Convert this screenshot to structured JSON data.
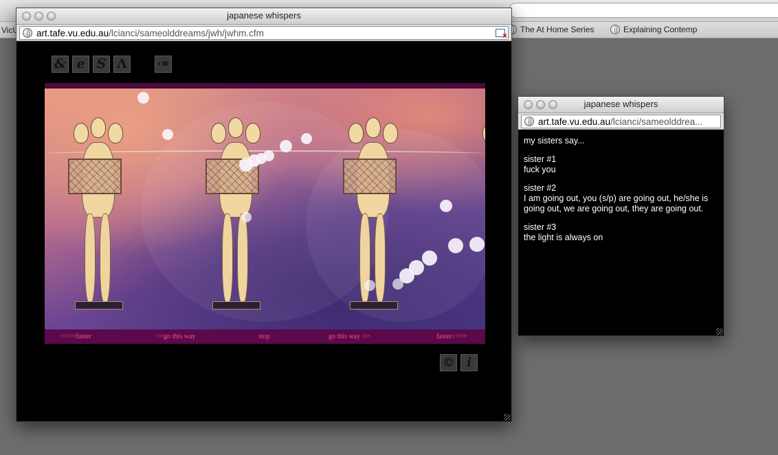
{
  "background_browser": {
    "bookmark_left": "VicU",
    "bookmarks": [
      {
        "label": "The At Home Series"
      },
      {
        "label": "Explaining Contemp"
      }
    ]
  },
  "main_window": {
    "title": "japanese whispers",
    "url_host": "art.tafe.vu.edu.au",
    "url_path": "/lcianci/sameolddreams/jwh/jwhm.cfm",
    "nav_icons": [
      {
        "name": "ampersand-icon",
        "glyph": "&"
      },
      {
        "name": "e-icon",
        "glyph": "e"
      },
      {
        "name": "s-icon",
        "glyph": "S"
      },
      {
        "name": "caret-up-icon",
        "glyph": "Λ"
      },
      {
        "name": "back-menu-icon",
        "glyph": "‹≡"
      }
    ],
    "controls": {
      "faster_left": "<<<<faster",
      "go_left": "<<go this way",
      "stop": "stop",
      "go_right": "go this way >>",
      "faster_right": "faster>>>>"
    },
    "footer_icons": [
      {
        "name": "copyright-icon",
        "glyph": "©"
      },
      {
        "name": "info-icon",
        "glyph": "i"
      }
    ]
  },
  "side_window": {
    "title": "japanese whispers",
    "url_host": "art.tafe.vu.edu.au",
    "url_path": "/lcianci/sameolddrea...",
    "intro": "my sisters say...",
    "sisters": [
      {
        "label": "sister #1",
        "text": "fuck you"
      },
      {
        "label": "sister #2",
        "text": "I am going out, you (s/p) are going out, he/she is going out, we are going out, they are going out."
      },
      {
        "label": "sister #3",
        "text": "the light is always on"
      }
    ]
  },
  "colors": {
    "control_text": "#ff4f8f",
    "control_bar": "#5a0a4a",
    "desktop": "#6d6d6d"
  }
}
